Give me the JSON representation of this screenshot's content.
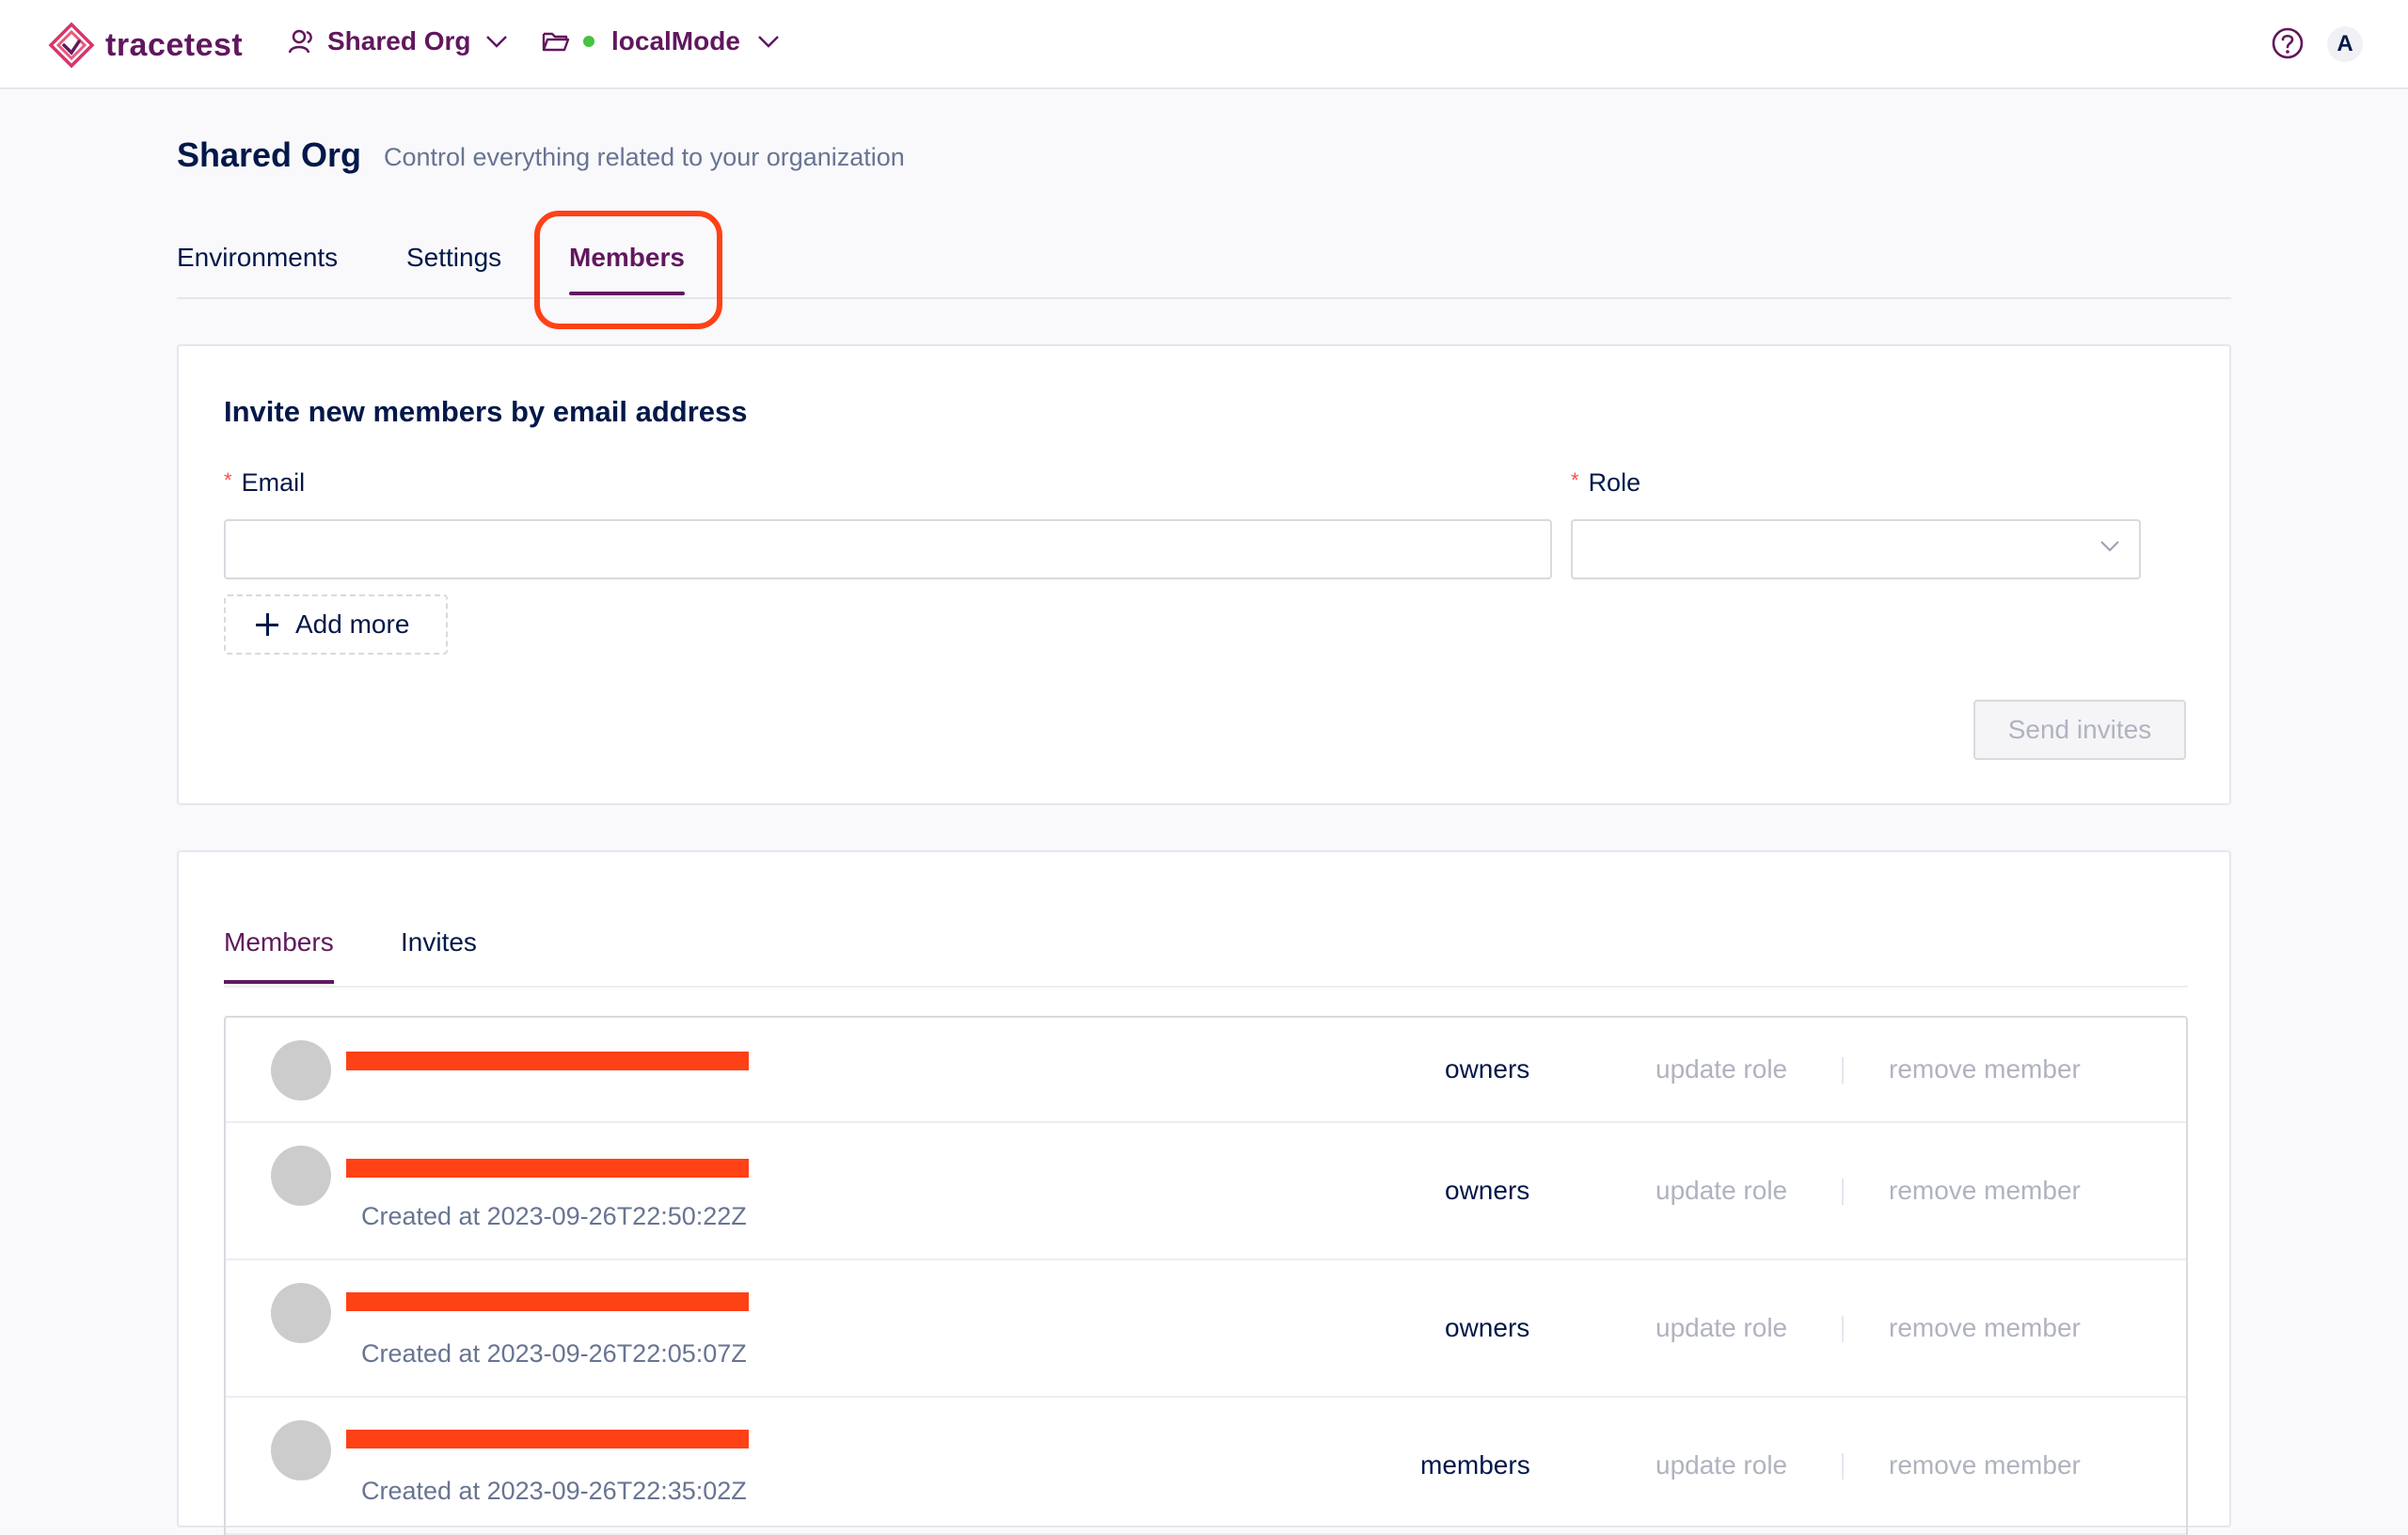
{
  "brand": {
    "name": "tracetest",
    "logo_icon": "tracetest-logo"
  },
  "topnav": {
    "org_name": "Shared Org",
    "org_icon": "user-icon",
    "env_name": "localMode",
    "env_icon": "folder-icon",
    "env_status_color": "#46c341",
    "help_icon": "help-icon",
    "avatar_initial": "A"
  },
  "colors": {
    "accent": "#61175e",
    "highlight": "#ff4116",
    "text": "#031849",
    "muted": "#687492"
  },
  "page": {
    "title": "Shared Org",
    "subtitle": "Control everything related to your organization"
  },
  "tabs": [
    {
      "label": "Environments",
      "active": false
    },
    {
      "label": "Settings",
      "active": false
    },
    {
      "label": "Members",
      "active": true
    }
  ],
  "invite": {
    "title": "Invite new members by email address",
    "required_mark": "*",
    "email_label": "Email",
    "email_value": "",
    "role_label": "Role",
    "role_value": "",
    "add_more_label": "Add more",
    "send_label": "Send invites"
  },
  "members_section": {
    "subtabs": [
      {
        "label": "Members",
        "active": true
      },
      {
        "label": "Invites",
        "active": false
      }
    ],
    "update_label": "update role",
    "remove_label": "remove member",
    "rows": [
      {
        "created": "",
        "role": "owners"
      },
      {
        "created": "Created at 2023-09-26T22:50:22Z",
        "role": "owners"
      },
      {
        "created": "Created at 2023-09-26T22:05:07Z",
        "role": "owners"
      },
      {
        "created": "Created at 2023-09-26T22:35:02Z",
        "role": "members"
      }
    ]
  }
}
